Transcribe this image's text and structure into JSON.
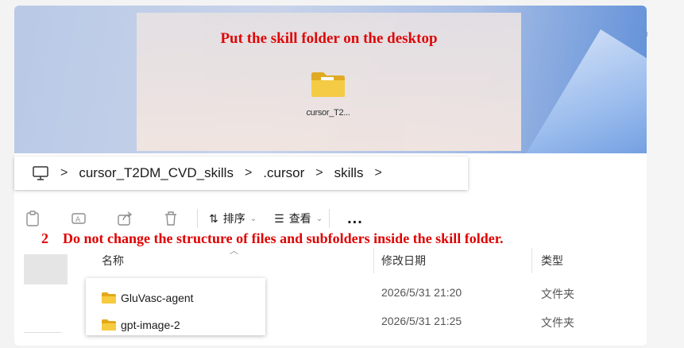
{
  "desktop": {
    "callout_title": "Put the skill folder on the desktop",
    "folder_label": "cursor_T2...",
    "folder_color": "#f2c12e"
  },
  "addressbar": {
    "icon": "computer-icon",
    "crumbs": [
      "cursor_T2DM_CVD_skills",
      ".cursor",
      "skills"
    ],
    "separator": ">"
  },
  "toolbar": {
    "icons": [
      "paste-icon",
      "rename-icon",
      "share-icon",
      "delete-icon"
    ],
    "sort_label": "排序",
    "view_label": "查看",
    "more_label": "..."
  },
  "note": {
    "number": "2",
    "text": "Do not change the structure of files and subfolders inside the skill folder."
  },
  "columns": {
    "name": "名称",
    "modified": "修改日期",
    "type": "类型"
  },
  "rows": [
    {
      "name": "GluVasc-agent",
      "modified": "2026/5/31 21:20",
      "type": "文件夹"
    },
    {
      "name": "gpt-image-2",
      "modified": "2026/5/31 21:25",
      "type": "文件夹"
    }
  ],
  "colors": {
    "annotation_red": "#e00000",
    "folder_yellow": "#f2c12e"
  }
}
